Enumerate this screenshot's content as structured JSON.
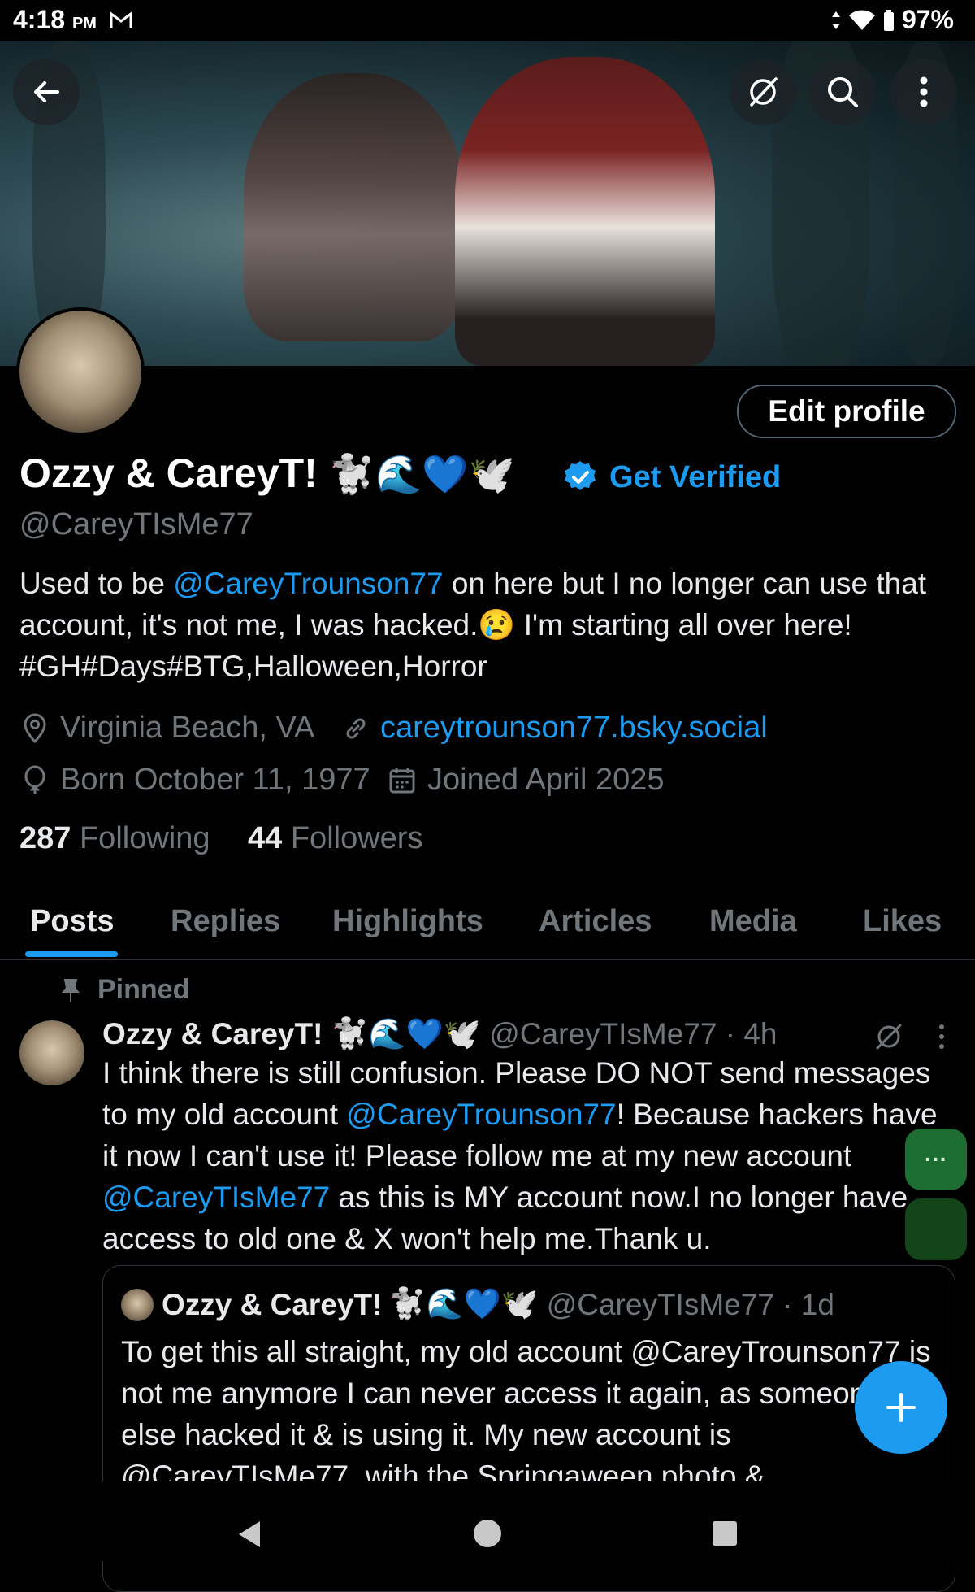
{
  "status_bar": {
    "time": "4:18",
    "ampm": "PM",
    "battery": "97%"
  },
  "profile": {
    "display_name": "Ozzy & CareyT!",
    "name_emojis": "🐩🌊💙🕊️",
    "get_verified": "Get Verified",
    "handle": "@CareyTIsMe77",
    "edit_button": "Edit profile",
    "bio": {
      "part1": "Used to be ",
      "mention": "@CareyTrounson77",
      "part2": " on here but I no longer can use that account, it's not me, I was hacked.😢 I'm starting all over here! #GH#Days#BTG,Halloween,Horror"
    },
    "location": "Virginia Beach, VA",
    "website": "careytrounson77.bsky.social",
    "born": "Born October 11, 1977",
    "joined": "Joined April 2025",
    "following_count": "287",
    "following_label": "Following",
    "followers_count": "44",
    "followers_label": "Followers"
  },
  "tabs": [
    "Posts",
    "Replies",
    "Highlights",
    "Articles",
    "Media",
    "Likes"
  ],
  "pinned_post": {
    "pinned_label": "Pinned",
    "author": "Ozzy & CareyT!",
    "author_emojis": "🐩🌊💙🕊️",
    "meta": "@CareyTIsMe77 · 4h",
    "text": {
      "p1": "I think there is still confusion. Please DO NOT send messages to my old account ",
      "m1": "@CareyTrounson77",
      "p2": "! Because hackers have it now I can't use it! Please follow me at my new account ",
      "m2": "@CareyTIsMe77",
      "p3": " as this is MY account now.I no longer have access to old one & X won't help me.Thank u."
    },
    "quote": {
      "author": "Ozzy & CareyT!",
      "author_emojis": "🐩🌊💙🕊️",
      "meta": "@CareyTIsMe77 · 1d",
      "text": "To get this all straight, my old account @CareyTrounson77 is not me anymore I can never access it again, as someone else hacked it & is using it. My new account is @CareyTIsMe77, with the Springaween photo &"
    }
  },
  "side_dock_label": "···",
  "colors": {
    "accent": "#1d9bf0",
    "muted": "#71767b",
    "text": "#e7e9ea",
    "background": "#000000"
  }
}
